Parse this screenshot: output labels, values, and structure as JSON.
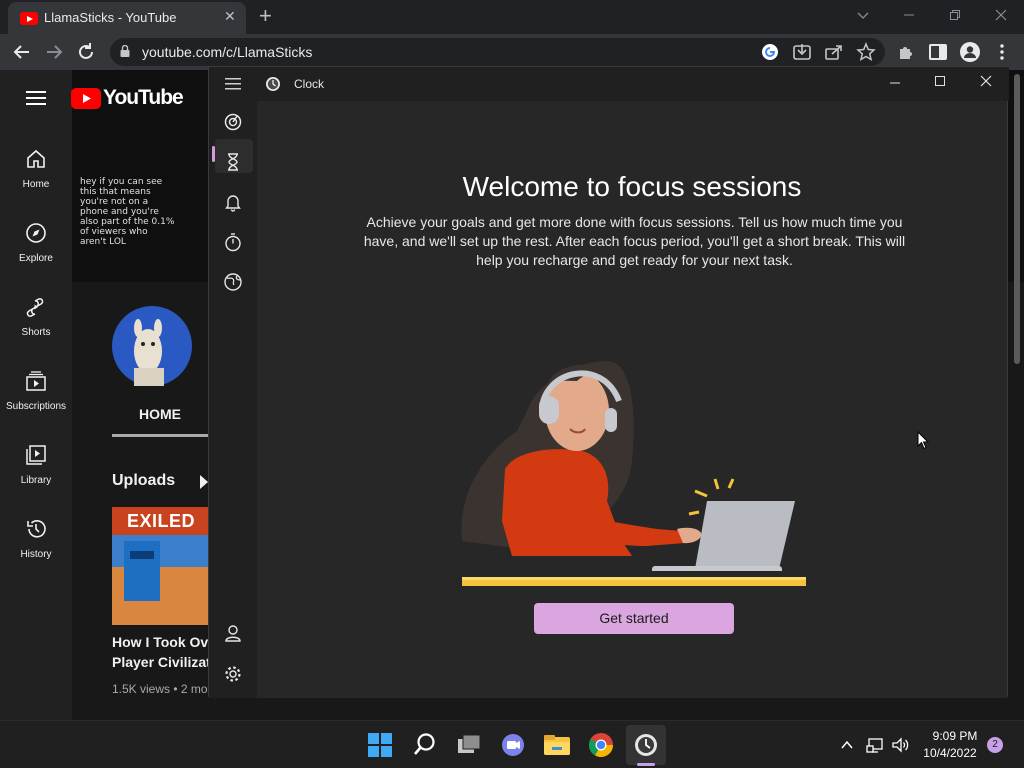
{
  "browser": {
    "tab_title": "LlamaSticks - YouTube",
    "tab_close": "✕",
    "new_tab": "+",
    "url": "youtube.com/c/LlamaSticks"
  },
  "youtube": {
    "logo_text": "YouTube",
    "nav": [
      {
        "label": "Home",
        "icon": "home-icon"
      },
      {
        "label": "Explore",
        "icon": "explore-icon"
      },
      {
        "label": "Shorts",
        "icon": "shorts-icon"
      },
      {
        "label": "Subscriptions",
        "icon": "subscriptions-icon"
      },
      {
        "label": "Library",
        "icon": "library-icon"
      },
      {
        "label": "History",
        "icon": "history-icon"
      }
    ],
    "banner_text": "hey if you can see this that means you're not on a phone and you're also part of the 0.1% of viewers who aren't LOL",
    "home_tab": "HOME",
    "uploads_heading": "Uploads",
    "video": {
      "thumb_text": "EXILED",
      "title_line1": "How I Took Ove",
      "title_line2": "Player Civilizati",
      "meta": "1.5K views • 2 mo"
    }
  },
  "clock": {
    "app_title": "Clock",
    "focus_title": "Welcome to focus sessions",
    "focus_description": "Achieve your goals and get more done with focus sessions. Tell us how much time you have, and we'll set up the rest. After each focus period, you'll get a short break. This will help you recharge and get ready for your next task.",
    "get_started_label": "Get started",
    "accent_color": "#dba5e0"
  },
  "taskbar": {
    "time": "9:09 PM",
    "date": "10/4/2022",
    "notification_count": "2"
  }
}
